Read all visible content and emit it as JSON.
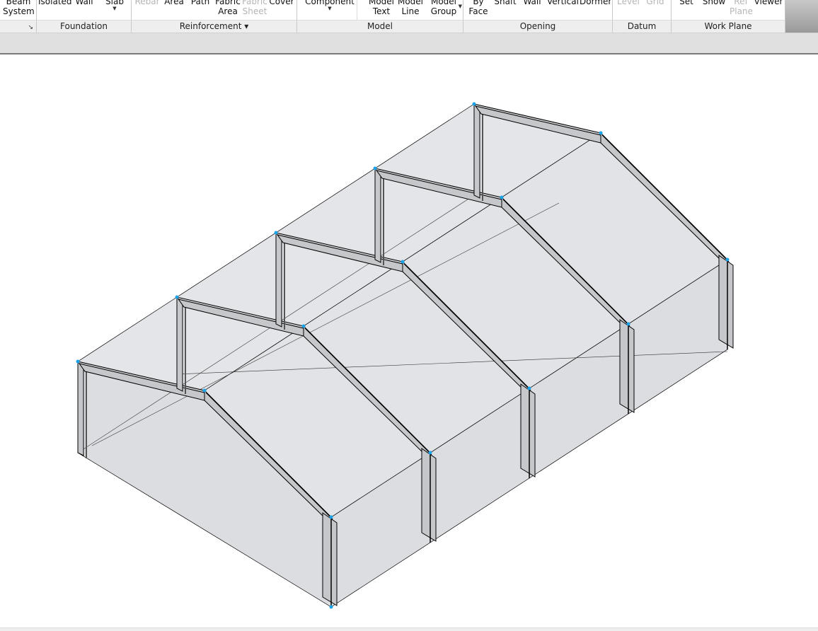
{
  "ribbon": {
    "panels": [
      {
        "id": "structure",
        "label": "",
        "buttons": [
          {
            "line1": "Beam",
            "line2": "System",
            "enabled": true
          }
        ],
        "has_launcher": true
      },
      {
        "id": "foundation",
        "label": "Foundation",
        "buttons": [
          {
            "line1": "Isolated",
            "line2": "",
            "enabled": true
          },
          {
            "line1": "Wall",
            "line2": "",
            "enabled": true
          },
          {
            "line1": "Slab",
            "line2": "",
            "enabled": true,
            "dropdown": true
          }
        ]
      },
      {
        "id": "reinforcement",
        "label": "Reinforcement ▾",
        "buttons": [
          {
            "line1": "Rebar",
            "line2": "",
            "enabled": false
          },
          {
            "line1": "Area",
            "line2": "",
            "enabled": true
          },
          {
            "line1": "Path",
            "line2": "",
            "enabled": true
          },
          {
            "line1": "Fabric",
            "line2": "Area",
            "enabled": true
          },
          {
            "line1": "Fabric",
            "line2": "Sheet",
            "enabled": false
          },
          {
            "line1": "Cover",
            "line2": "",
            "enabled": true
          }
        ]
      },
      {
        "id": "model",
        "label": "Model",
        "buttons": [
          {
            "line1": "Component",
            "line2": "",
            "enabled": true,
            "dropdown": true
          },
          {
            "line1": "Model",
            "line2": "Text",
            "enabled": true
          },
          {
            "line1": "Model",
            "line2": "Line",
            "enabled": true
          },
          {
            "line1": "Model",
            "line2": "Group",
            "enabled": true,
            "dropdown": true
          }
        ]
      },
      {
        "id": "opening",
        "label": "Opening",
        "buttons": [
          {
            "line1": "By",
            "line2": "Face",
            "enabled": true
          },
          {
            "line1": "Shaft",
            "line2": "",
            "enabled": true
          },
          {
            "line1": "Wall",
            "line2": "",
            "enabled": true
          },
          {
            "line1": "Vertical",
            "line2": "",
            "enabled": true
          },
          {
            "line1": "Dormer",
            "line2": "",
            "enabled": true
          }
        ]
      },
      {
        "id": "datum",
        "label": "Datum",
        "buttons": [
          {
            "line1": "Level",
            "line2": "",
            "enabled": false
          },
          {
            "line1": "Grid",
            "line2": "",
            "enabled": false
          }
        ]
      },
      {
        "id": "workplane",
        "label": "Work Plane",
        "buttons": [
          {
            "line1": "Set",
            "line2": "",
            "enabled": true
          },
          {
            "line1": "Show",
            "line2": "",
            "enabled": true
          },
          {
            "line1": "Ref",
            "line2": "Plane",
            "enabled": false
          },
          {
            "line1": "Viewer",
            "line2": "",
            "enabled": true
          }
        ]
      }
    ]
  },
  "viewport": {
    "view_type": "3D isometric",
    "model": "steel portal frame building",
    "frame_count": 4,
    "colors": {
      "surface": "#dcdde1",
      "member": "#c6c7ca",
      "edge": "#000000",
      "grip": "#1aa3e8"
    }
  }
}
